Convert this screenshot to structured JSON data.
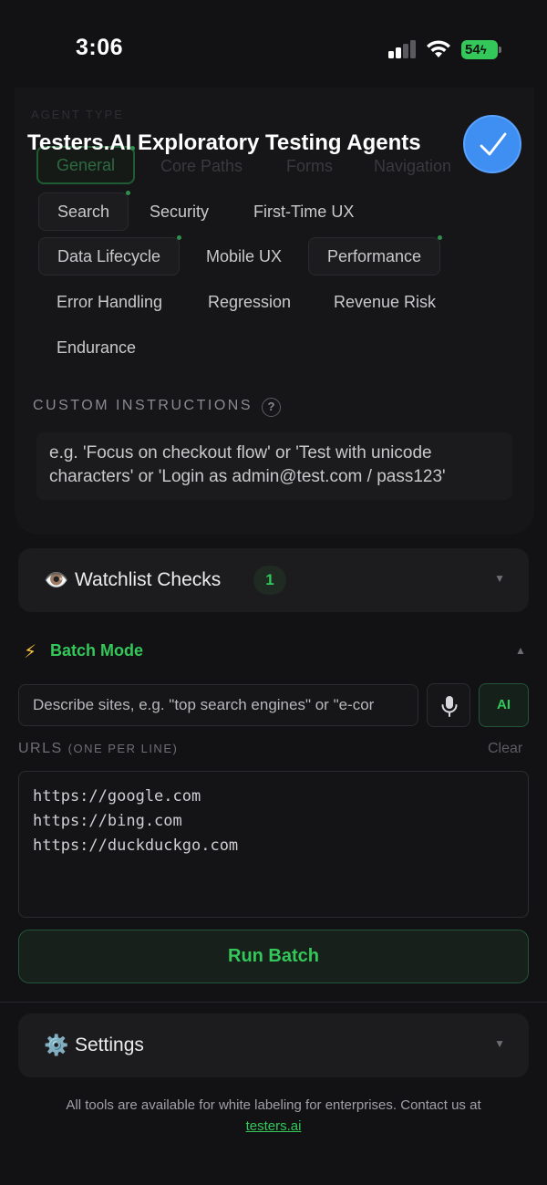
{
  "status_bar": {
    "time": "3:06",
    "battery": "54",
    "battery_color": "#34c759"
  },
  "header": {
    "ghost_label": "AGENT TYPE",
    "title": "Testers.AI Exploratory Testing Agents",
    "check_icon": "checkmark-icon",
    "accent": "#3f8ef2"
  },
  "agent_chips": {
    "ghost": [
      "General",
      "Core Paths",
      "Forms",
      "Navigation"
    ],
    "rows": [
      [
        "Search",
        "Security",
        "First-Time UX"
      ],
      [
        "Data Lifecycle",
        "Mobile UX",
        "Performance"
      ],
      [
        "Error Handling",
        "Regression",
        "Revenue Risk"
      ],
      [
        "Endurance"
      ]
    ]
  },
  "custom_instructions": {
    "label": "CUSTOM INSTRUCTIONS",
    "help": "?",
    "placeholder_line1": "e.g. 'Focus on checkout flow' or 'Test with unicode",
    "placeholder_line2": "characters' or 'Login as admin@test.com / pass123'"
  },
  "watchlist": {
    "icon": "👁️",
    "label": "Watchlist Checks",
    "count": "1",
    "chevron": "▼"
  },
  "batch": {
    "icon": "⚡",
    "title": "Batch Mode",
    "chevron": "▲",
    "describe_placeholder": "Describe sites, e.g. \"top search engines\" or \"e-cor",
    "ai_label": "AI",
    "urls_label": "URLS",
    "urls_sub": "(ONE PER LINE)",
    "clear_label": "Clear",
    "urls": [
      "https://google.com",
      "https://bing.com",
      "https://duckduckgo.com"
    ],
    "run_label": "Run Batch",
    "accent": "#34c759"
  },
  "settings": {
    "icon": "⚙️",
    "label": "Settings",
    "chevron": "▼"
  },
  "footer": {
    "text": "All tools are available for white labeling for enterprises. Contact us at",
    "link": "testers.ai"
  }
}
